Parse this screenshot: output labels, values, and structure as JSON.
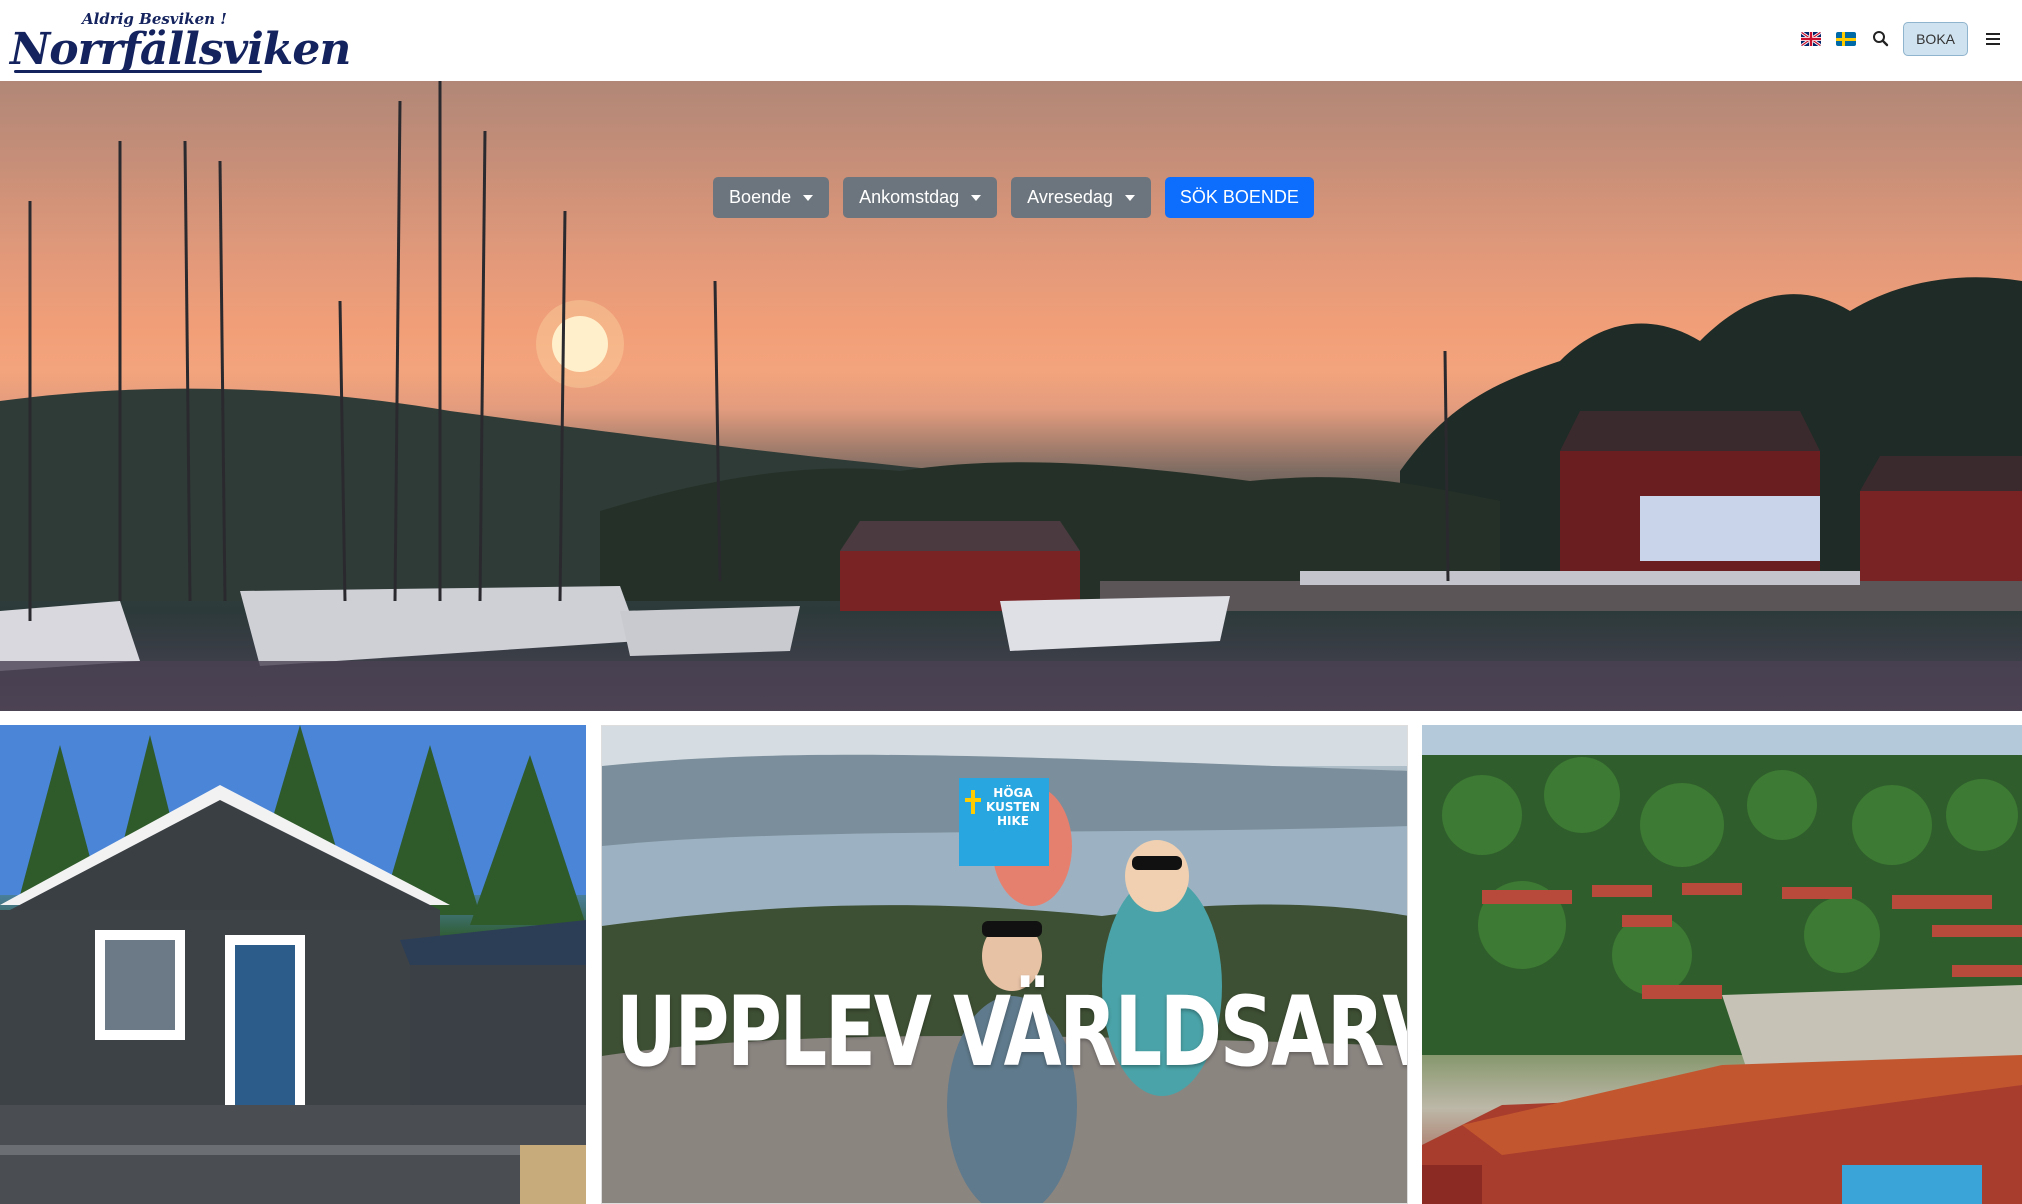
{
  "header": {
    "logo_tagline": "Aldrig Besviken !",
    "logo_name": "Norrfällsviken",
    "flags": [
      "flag-uk-icon",
      "flag-se-icon"
    ],
    "search_icon": "search-icon",
    "boka_label": "BOKA",
    "menu_icon": "hamburger-menu-icon"
  },
  "search_bar": {
    "boende_label": "Boende",
    "ankomstdag_label": "Ankomstdag",
    "avresedag_label": "Avresedag",
    "sok_label": "SÖK BOENDE"
  },
  "cards": {
    "card1_alt": "",
    "card2": {
      "headline": "UPPLEV VÄRLDSARVET",
      "badge_line1": "HÖGA",
      "badge_line2": "KUSTEN",
      "badge_line3": "HIKE"
    },
    "card3_alt": ""
  },
  "colors": {
    "brand_navy": "#14235e",
    "primary_blue": "#0d6efd",
    "secondary_gray": "#6c757d",
    "boka_bg": "#cfe2ef"
  }
}
